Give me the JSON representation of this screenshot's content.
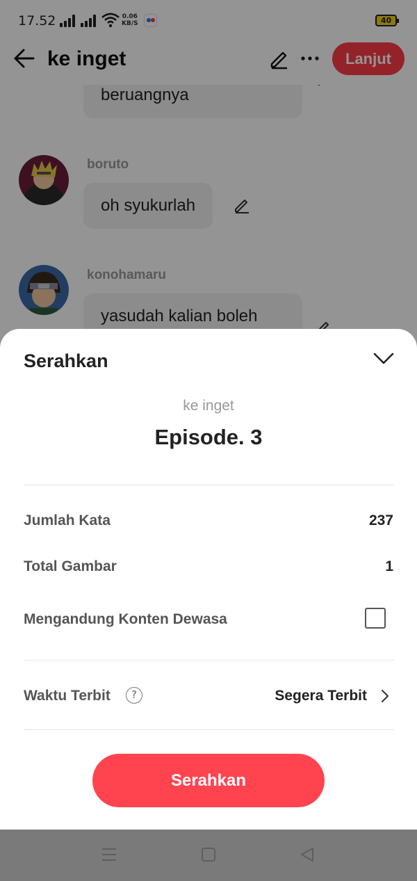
{
  "status_bar": {
    "time": "17.52",
    "net_speed_value": "0.06",
    "net_speed_unit": "KB/S",
    "battery": "40"
  },
  "app_bar": {
    "title": "ke inget",
    "next_button": "Lanjut"
  },
  "chat": [
    {
      "sender": "",
      "text": "beruangnya"
    },
    {
      "sender": "boruto",
      "text": "oh syukurlah"
    },
    {
      "sender": "konohamaru",
      "text": "yasudah kalian boleh"
    }
  ],
  "sheet": {
    "title": "Serahkan",
    "series_name": "ke inget",
    "episode_title": "Episode. 3",
    "word_count_label": "Jumlah Kata",
    "word_count_value": "237",
    "image_total_label": "Total Gambar",
    "image_total_value": "1",
    "adult_content_label": "Mengandung Konten Dewasa",
    "adult_content_checked": false,
    "publish_time_label": "Waktu Terbit",
    "publish_time_value": "Segera Terbit",
    "submit_button": "Serahkan"
  },
  "colors": {
    "accent": "#ff4450",
    "overlay": "rgba(0,0,0,0.42)"
  }
}
